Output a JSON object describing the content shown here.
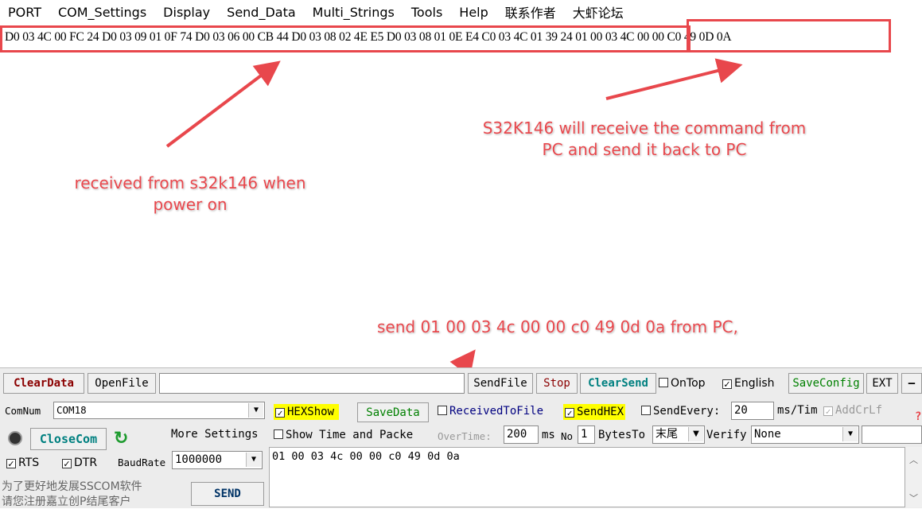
{
  "menu": [
    "PORT",
    "COM_Settings",
    "Display",
    "Send_Data",
    "Multi_Strings",
    "Tools",
    "Help",
    "联系作者",
    "大虾论坛"
  ],
  "receive": {
    "line_part1": "D0 03 4C 00 FC 24 D0 03 09 01 0F 74 D0 03 06 00 CB 44 D0 03 08 02 4E E5 D0 03 08 01 0E E4 C0 03 4C 01 39 24",
    "line_part2": "01 00 03 4C 00 00 C0 49 0D 0A"
  },
  "annotations": {
    "power_on": [
      "received from s32k146 when",
      "power on"
    ],
    "echo": [
      "S32K146 will receive the command from",
      "PC and send it back to PC"
    ],
    "send": "send 01 00 03 4c 00 00 c0 49 0d 0a from PC,"
  },
  "toolbar": {
    "clear_data": "ClearData",
    "open_file": "OpenFile",
    "send_file": "SendFile",
    "stop": "Stop",
    "clear_send": "ClearSend",
    "on_top": "OnTop",
    "english": "English",
    "save_config": "SaveConfig",
    "ext": "EXT",
    "minus": "—"
  },
  "port": {
    "com_num_label": "ComNum",
    "com_num_value": "COM18",
    "close_com": "CloseCom",
    "more_settings": "More Settings",
    "rts": "RTS",
    "dtr": "DTR",
    "baud_label": "BaudRate",
    "baud_value": "1000000",
    "promo_line1": "为了更好地发展SSCOM软件",
    "promo_line2": "请您注册嘉立创P结尾客户",
    "send_button": "SEND"
  },
  "options": {
    "hex_show": "HEXShow",
    "save_data": "SaveData",
    "received_to_file": "ReceivedToFile",
    "send_hex": "SendHEX",
    "send_every": "SendEvery:",
    "send_every_value": "20",
    "ms_tim": "ms/Tim",
    "add_crlf": "AddCrLf",
    "show_time": "Show Time and Packe",
    "overtime": "OverTime:",
    "overtime_value": "200",
    "ms": "ms",
    "no": "No",
    "no_value": "1",
    "bytes_to": "BytesTo",
    "bytes_to_value": "末尾",
    "verify": "Verify",
    "verify_value": "None",
    "help_mark": "?"
  },
  "send_text": "01 00 03 4c 00 00 c0 49 0d 0a",
  "colors": {
    "annotation": "#e8474c",
    "hex_highlight": "#ffff00",
    "close_com": "#008080",
    "clear_data": "#8b0000"
  }
}
